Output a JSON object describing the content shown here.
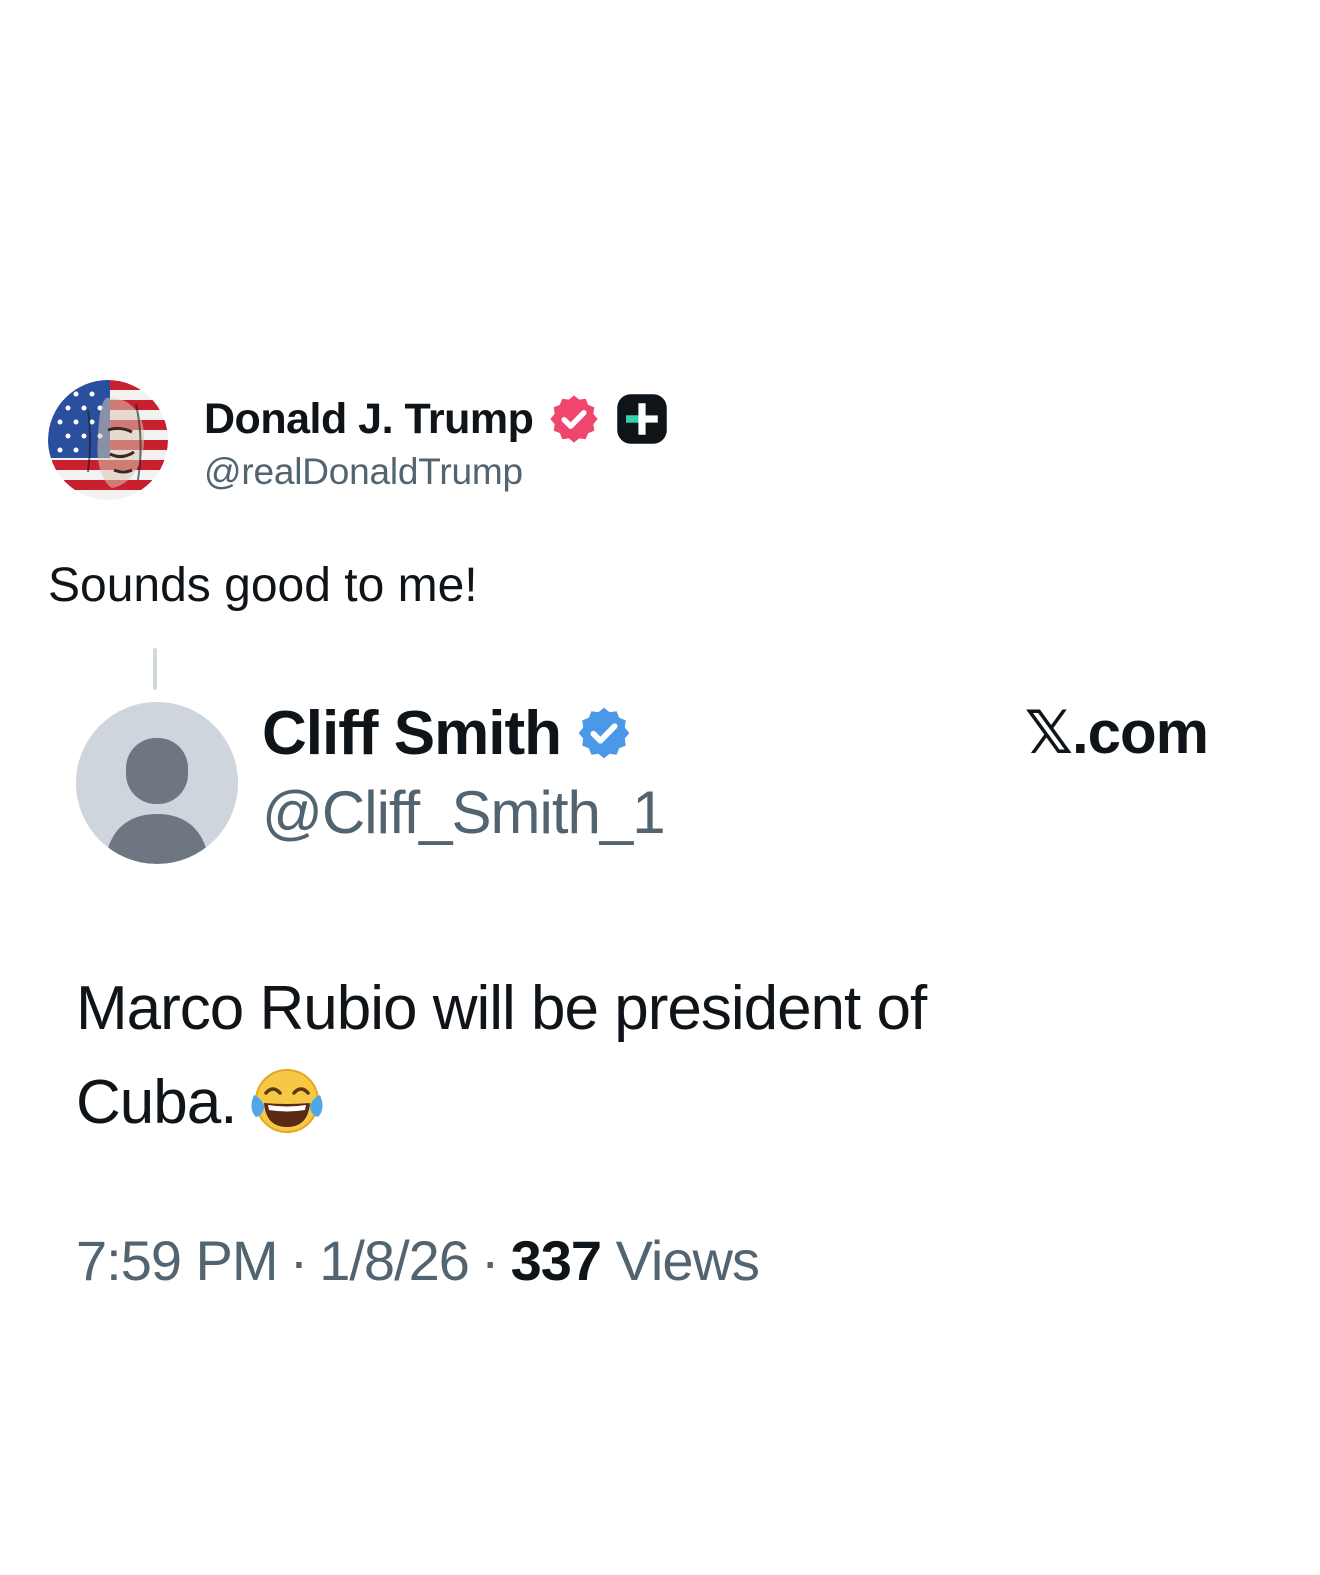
{
  "post": {
    "author_name": "Donald J. Trump",
    "author_handle": "@realDonaldTrump",
    "text": "Sounds good to me!",
    "verified_badge_color": "#f0466e",
    "extra_badge": "plus-badge"
  },
  "quoted_post": {
    "author_name": "Cliff Smith",
    "author_handle": "@Cliff_Smith_1",
    "verified_badge_color": "#4a99e9",
    "site_label": "𝕏.com",
    "text_line1": "Marco Rubio will be president of",
    "text_line2": "Cuba.",
    "emoji": "face-with-tears-of-joy",
    "time": "7:59 PM",
    "date": "1/8/26",
    "separator": "·",
    "views_count": "337",
    "views_label": "Views"
  }
}
